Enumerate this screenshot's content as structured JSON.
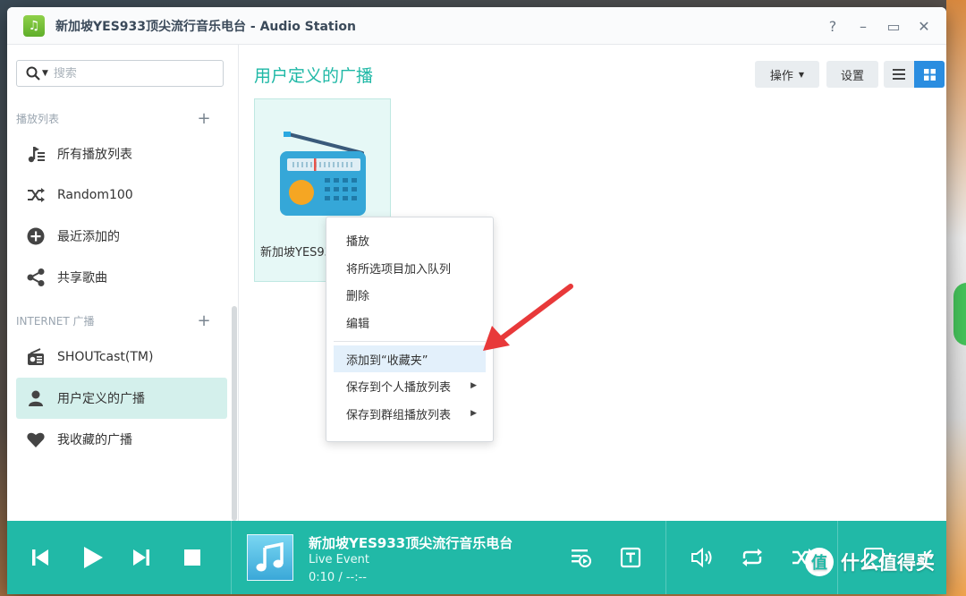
{
  "window": {
    "title": "新加坡YES933顶尖流行音乐电台 - Audio Station",
    "controls": [
      "?",
      "–",
      "▭",
      "✕"
    ]
  },
  "sidebar": {
    "search_placeholder": "搜索",
    "playlists_header": "播放列表",
    "playlist_items": [
      {
        "label": "所有播放列表",
        "icon": "music-list-icon"
      },
      {
        "label": "Random100",
        "icon": "shuffle-icon"
      },
      {
        "label": "最近添加的",
        "icon": "plus-circle-icon"
      },
      {
        "label": "共享歌曲",
        "icon": "share-icon"
      }
    ],
    "internet_header": "INTERNET 广播",
    "internet_items": [
      {
        "label": "SHOUTcast(TM)",
        "icon": "radio-icon"
      },
      {
        "label": "用户定义的广播",
        "icon": "user-icon",
        "active": true
      },
      {
        "label": "我收藏的广播",
        "icon": "heart-icon"
      }
    ]
  },
  "main": {
    "title": "用户定义的广播",
    "toolbar": {
      "operations": "操作",
      "settings": "设置"
    },
    "tile_label": "新加坡YES933顶尖流行音乐电台"
  },
  "context_menu": {
    "items": [
      {
        "label": "播放"
      },
      {
        "label": "将所选项目加入队列"
      },
      {
        "label": "删除"
      },
      {
        "label": "编辑"
      },
      {
        "label": "添加到“收藏夹”",
        "highlighted": true
      },
      {
        "label": "保存到个人播放列表",
        "submenu": true
      },
      {
        "label": "保存到群组播放列表",
        "submenu": true
      }
    ]
  },
  "player": {
    "title": "新加坡YES933顶尖流行音乐电台",
    "artist": "Live Event",
    "time": "0:10 / --:--"
  },
  "watermark": "什么值得买",
  "colors": {
    "accent": "#21b9a7",
    "title_accent": "#1fb8a6",
    "active_bg": "#d4f0ec",
    "grid_btn": "#2a8de0",
    "arrow": "#e8393a"
  }
}
